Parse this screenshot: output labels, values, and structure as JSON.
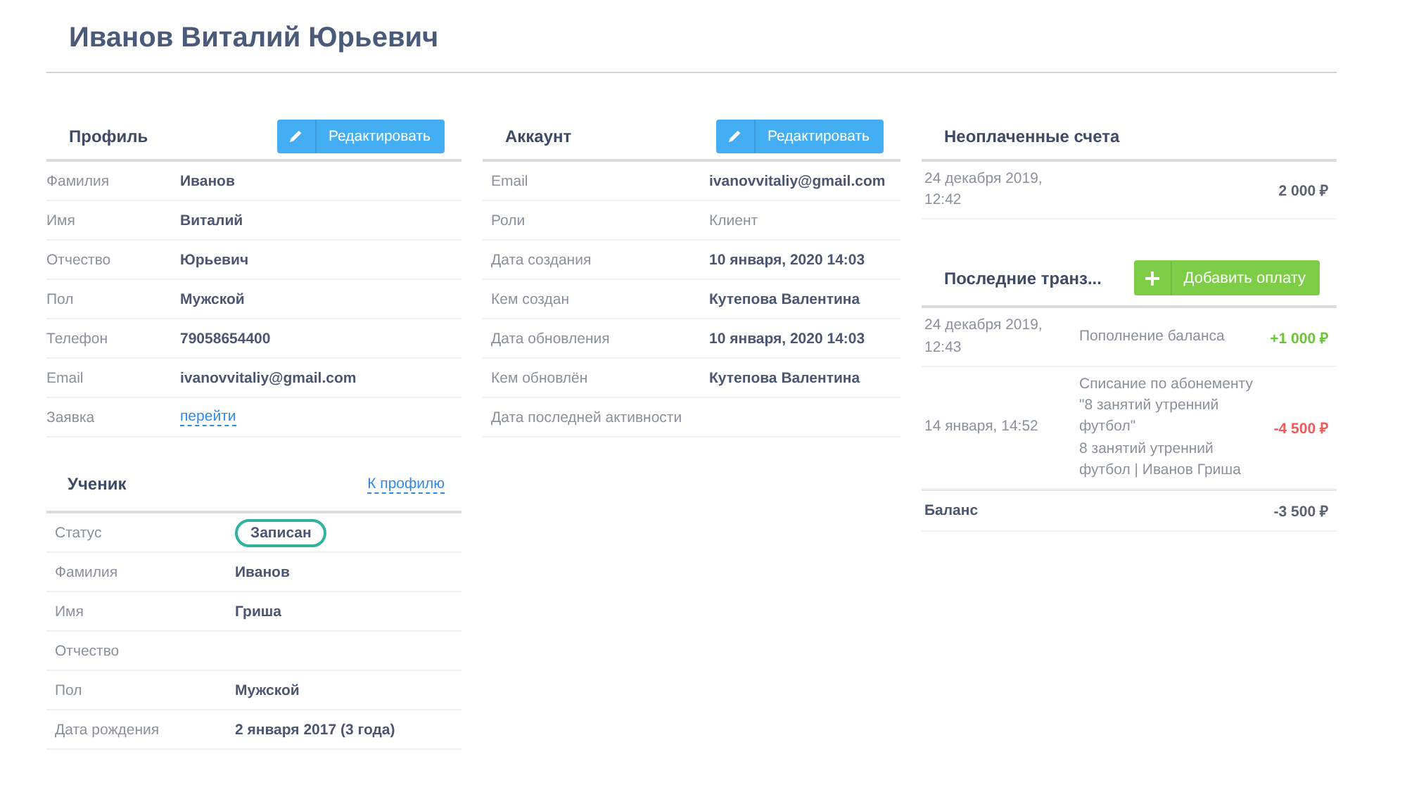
{
  "title": "Иванов Виталий Юрьевич",
  "profile": {
    "heading": "Профиль",
    "button": "Редактировать",
    "rows": [
      {
        "label": "Фамилия",
        "value": "Иванов",
        "kind": "bold"
      },
      {
        "label": "Имя",
        "value": "Виталий",
        "kind": "bold"
      },
      {
        "label": "Отчество",
        "value": "Юрьевич",
        "kind": "bold"
      },
      {
        "label": "Пол",
        "value": "Мужской",
        "kind": "bold"
      },
      {
        "label": "Телефон",
        "value": "79058654400",
        "kind": "bold"
      },
      {
        "label": "Email",
        "value": "ivanovvitaliy@gmail.com",
        "kind": "bold"
      },
      {
        "label": "Заявка",
        "value": "перейти",
        "kind": "link"
      }
    ]
  },
  "student": {
    "heading": "Ученик",
    "link": "К профилю",
    "rows": [
      {
        "label": "Статус",
        "value": "Записан",
        "kind": "badge"
      },
      {
        "label": "Фамилия",
        "value": "Иванов",
        "kind": "bold"
      },
      {
        "label": "Имя",
        "value": "Гриша",
        "kind": "bold"
      },
      {
        "label": "Отчество"
      },
      {
        "label": "Пол",
        "value": "Мужской",
        "kind": "bold"
      },
      {
        "label": "Дата рождения",
        "value": "2 января 2017 (3 года)",
        "kind": "bold"
      }
    ]
  },
  "account": {
    "heading": "Аккаунт",
    "button": "Редактировать",
    "rows": [
      {
        "label": "Email",
        "value": "ivanovvitaliy@gmail.com",
        "kind": "bold"
      },
      {
        "label": "Роли",
        "value": "Клиент",
        "kind": "plain"
      },
      {
        "label": "Дата создания",
        "value": "10 января, 2020 14:03",
        "kind": "bold"
      },
      {
        "label": "Кем создан",
        "value": "Кутепова Валентина",
        "kind": "bold"
      },
      {
        "label": "Дата обновления",
        "value": "10 января, 2020 14:03",
        "kind": "bold"
      },
      {
        "label": "Кем обновлён",
        "value": "Кутепова Валентина",
        "kind": "bold"
      },
      {
        "label": "Дата последней активности"
      }
    ]
  },
  "unpaid": {
    "heading": "Неоплаченные счета",
    "rows": [
      {
        "date": "24 декабря 2019, 12:42",
        "amount": "2 000 ₽"
      }
    ]
  },
  "transactions": {
    "heading": "Последние транз...",
    "button": "Добавить оплату",
    "rows": [
      {
        "date": "24 декабря 2019, 12:43",
        "description": "Пополнение баланса",
        "amount": "+1 000 ₽",
        "kind": "credit"
      },
      {
        "date": "14 января, 14:52",
        "description": "Списание по абонементу \"8 занятий утренний футбол\"",
        "note": "8 занятий утренний футбол | Иванов Гриша",
        "amount": "-4 500 ₽",
        "kind": "debit"
      }
    ],
    "balance": {
      "label": "Баланс",
      "amount": "-3 500 ₽"
    }
  }
}
